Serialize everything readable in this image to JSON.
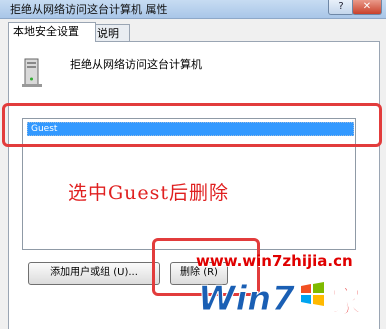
{
  "window": {
    "title": "拒绝从网络访问这台计算机 属性",
    "help_glyph": "?",
    "close_glyph": "✕"
  },
  "tabs": [
    {
      "label": "本地安全设置",
      "active": true
    },
    {
      "label": "说明",
      "active": false
    }
  ],
  "policy": {
    "icon": "computer-tower-icon",
    "name": "拒绝从网络访问这台计算机"
  },
  "list": {
    "items": [
      {
        "label": "Guest",
        "selected": true
      }
    ]
  },
  "annotation": {
    "text": "选中Guest后删除",
    "color": "#e02020"
  },
  "buttons": {
    "add_label": "添加用户或组 (U)...",
    "remove_label": "删除 (R)"
  },
  "watermark": {
    "url": "www.win7zhijia.cn",
    "logo_text_1": "Win7",
    "logo_text_2": "家",
    "colors": {
      "red": "#e00000",
      "blue": "#1a5fb4"
    }
  }
}
